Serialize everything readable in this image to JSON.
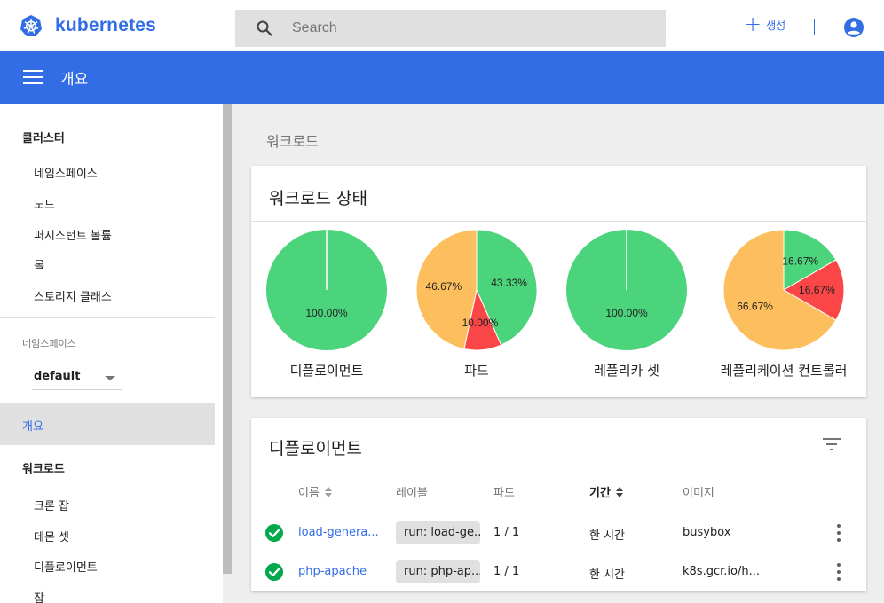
{
  "header": {
    "brand": "kubernetes",
    "search_placeholder": "Search",
    "create_label": "생성",
    "brand_color": "#326de6"
  },
  "titlebar": {
    "title": "개요"
  },
  "sidebar": {
    "cluster": {
      "heading": "클러스터",
      "items": [
        "네임스페이스",
        "노드",
        "퍼시스턴트 볼륨",
        "롤",
        "스토리지 클래스"
      ]
    },
    "namespace": {
      "label": "네임스페이스",
      "value": "default"
    },
    "overview": "개요",
    "workloads": {
      "heading": "워크로드",
      "items": [
        "크론 잡",
        "데몬 셋",
        "디플로이먼트",
        "잡"
      ]
    }
  },
  "content": {
    "heading": "워크로드",
    "status_card": {
      "title": "워크로드 상태",
      "colors": {
        "running": "#4cd47d",
        "pending": "#fdbf5e",
        "failed": "#fb4647"
      }
    },
    "deployments_card": {
      "title": "디플로이먼트",
      "columns": {
        "name": "이름",
        "labels": "레이블",
        "pods": "파드",
        "age": "기간",
        "images": "이미지"
      },
      "rows": [
        {
          "name": "load-genera...",
          "label": "run: load-ge...",
          "pods": "1 / 1",
          "age": "한 시간",
          "image": "busybox",
          "status": "ok"
        },
        {
          "name": "php-apache",
          "label": "run: php-ap...",
          "pods": "1 / 1",
          "age": "한 시간",
          "image": "k8s.gcr.io/h...",
          "status": "ok"
        }
      ]
    }
  },
  "chart_data": [
    {
      "type": "pie",
      "title": "디플로이먼트",
      "series": [
        {
          "values": [
            100.0
          ]
        }
      ],
      "labels_shown": [
        "100.00%"
      ]
    },
    {
      "type": "pie",
      "title": "파드",
      "series": [
        {
          "values": [
            43.33,
            10.0,
            46.67
          ]
        }
      ],
      "labels_shown": [
        "43.33%",
        "10.00%",
        "46.67%"
      ]
    },
    {
      "type": "pie",
      "title": "레플리카 셋",
      "series": [
        {
          "values": [
            100.0
          ]
        }
      ],
      "labels_shown": [
        "100.00%"
      ]
    },
    {
      "type": "pie",
      "title": "레플리케이션 컨트롤러",
      "series": [
        {
          "values": [
            16.67,
            16.67,
            66.67
          ]
        }
      ],
      "labels_shown": [
        "16.67%",
        "16.67%",
        "66.67%"
      ]
    }
  ]
}
